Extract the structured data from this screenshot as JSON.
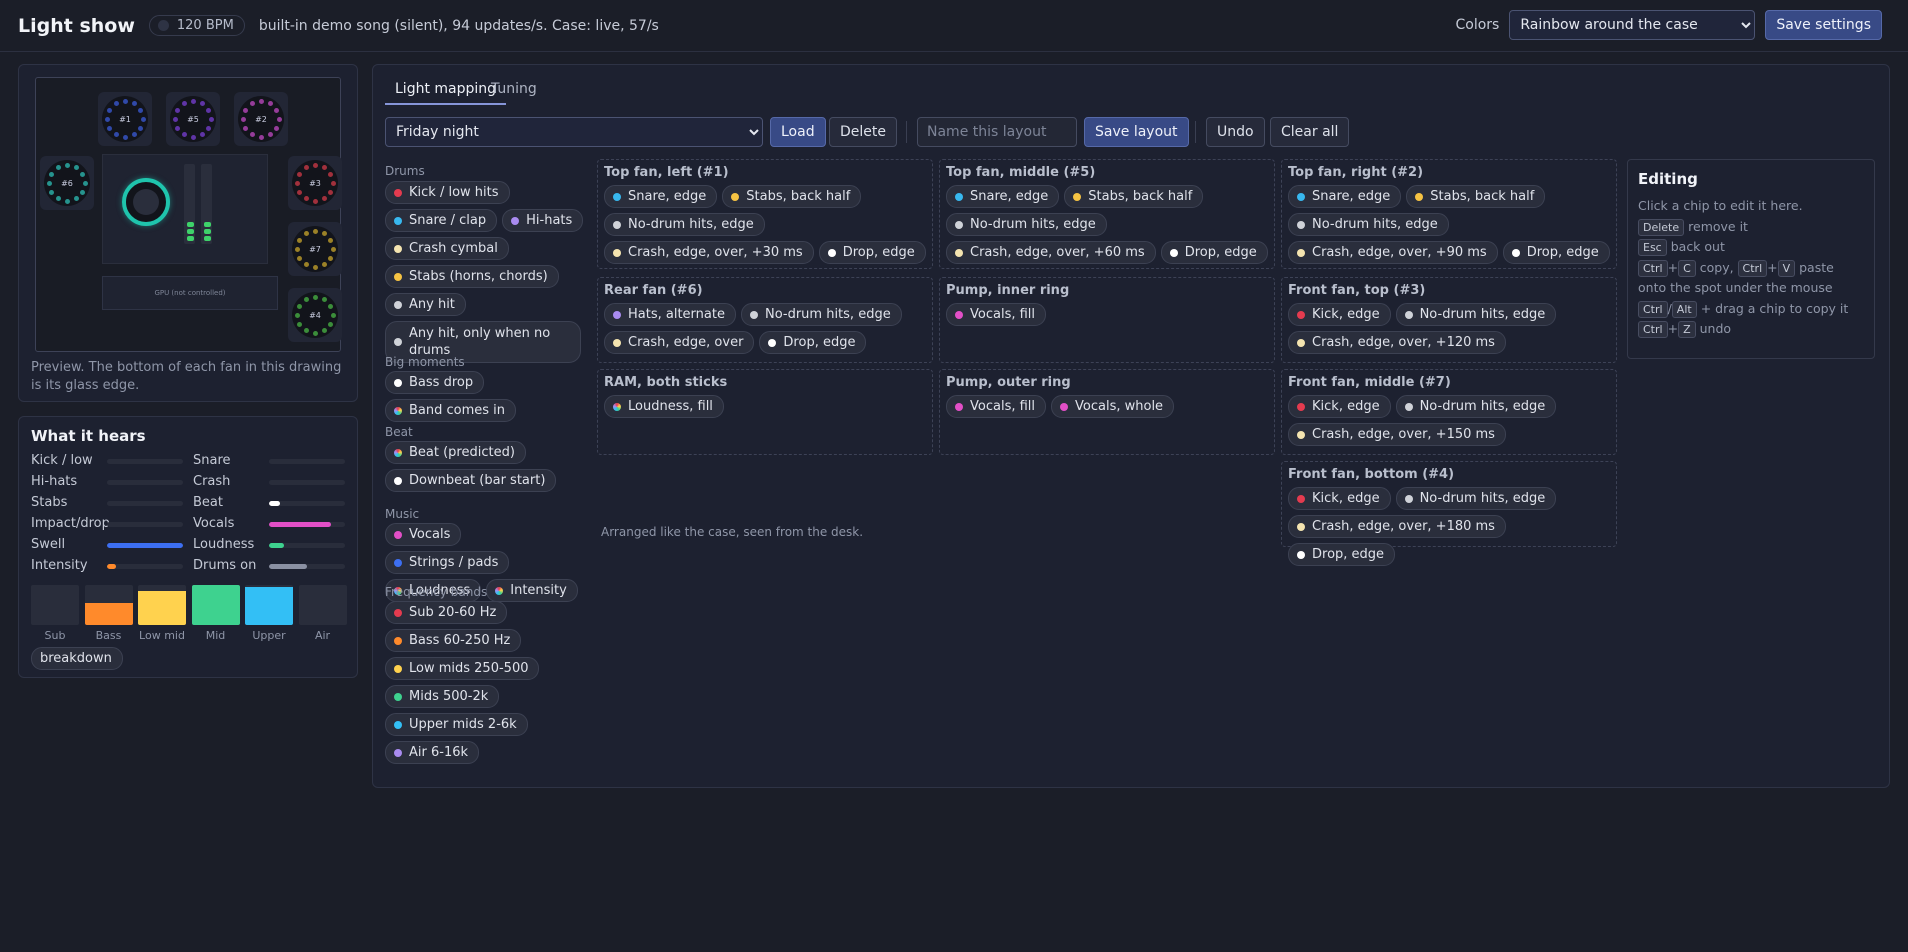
{
  "header": {
    "title": "Light show",
    "bpm": "120 BPM",
    "status": "built-in demo song (silent), 94 updates/s. Case: live, 57/s",
    "colors_label": "Colors",
    "colors_value": "Rainbow around the case",
    "save_settings": "Save settings"
  },
  "preview": {
    "gpu_label": "GPU (not controlled)",
    "caption": "Preview. The bottom of each fan in this drawing is its glass edge.",
    "fans": [
      {
        "id": "#1",
        "color": "#3b5bd9"
      },
      {
        "id": "#5",
        "color": "#7a3fd6"
      },
      {
        "id": "#2",
        "color": "#c24ac4"
      },
      {
        "id": "#6",
        "color": "#2dbdb5"
      },
      {
        "id": "#3",
        "color": "#d23a48"
      },
      {
        "id": "#7",
        "color": "#caa52c"
      },
      {
        "id": "#4",
        "color": "#4ab646"
      }
    ]
  },
  "hears": {
    "title": "What it hears",
    "meters": [
      {
        "label": "Kick / low",
        "level": 0,
        "color": "#555a6a"
      },
      {
        "label": "Snare",
        "level": 0,
        "color": "#555a6a"
      },
      {
        "label": "Hi-hats",
        "level": 0,
        "color": "#555a6a"
      },
      {
        "label": "Crash",
        "level": 0,
        "color": "#555a6a"
      },
      {
        "label": "Stabs",
        "level": 0,
        "color": "#555a6a"
      },
      {
        "label": "Beat",
        "level": 0.14,
        "color": "#ffffff"
      },
      {
        "label": "Impact/drop",
        "level": 0,
        "color": "#555a6a"
      },
      {
        "label": "Vocals",
        "level": 0.82,
        "color": "#e24fc7"
      },
      {
        "label": "Swell",
        "level": 1.0,
        "color": "#3d6ff2"
      },
      {
        "label": "Loudness",
        "level": 0.2,
        "color": "#3ed28f"
      },
      {
        "label": "Intensity",
        "level": 0.12,
        "color": "#ff8a2b"
      },
      {
        "label": "Drums on",
        "level": 0.5,
        "color": "#8a90a2"
      }
    ],
    "bands": [
      {
        "label": "Sub",
        "level": 0,
        "color": "#2a2e3c"
      },
      {
        "label": "Bass",
        "level": 0.55,
        "color": "#ff8a2b"
      },
      {
        "label": "Low mid",
        "level": 0.85,
        "color": "#ffd24e"
      },
      {
        "label": "Mid",
        "level": 1.0,
        "color": "#3ed28f"
      },
      {
        "label": "Upper",
        "level": 0.95,
        "color": "#33bff5"
      },
      {
        "label": "Air",
        "level": 0,
        "color": "#2a2e3c"
      }
    ],
    "breakdown": "breakdown"
  },
  "tabs": [
    {
      "label": "Light mapping",
      "active": true
    },
    {
      "label": "Tuning",
      "active": false
    }
  ],
  "toolbar": {
    "layout_value": "Friday night",
    "load": "Load",
    "delete": "Delete",
    "name_placeholder": "Name this layout",
    "save_layout": "Save layout",
    "undo": "Undo",
    "clear_all": "Clear all"
  },
  "palette": [
    {
      "title": "Drums",
      "chips": [
        {
          "label": "Kick / low hits",
          "color": "#e43b4f"
        },
        {
          "label": "Snare / clap",
          "color": "#38b8ef"
        },
        {
          "label": "Hi-hats",
          "color": "#a98bf0"
        },
        {
          "label": "Crash cymbal",
          "color": "#f4e4b0"
        },
        {
          "label": "Stabs (horns, chords)",
          "color": "#f6c343"
        },
        {
          "label": "Any hit",
          "color": "#cfd2d8"
        },
        {
          "label": "Any hit, only when no drums",
          "color": "#cfd2d8"
        }
      ]
    },
    {
      "title": "Big moments",
      "chips": [
        {
          "label": "Bass drop",
          "color": "#ffffff"
        },
        {
          "label": "Band comes in",
          "color": "multi"
        }
      ]
    },
    {
      "title": "Beat",
      "chips": [
        {
          "label": "Beat (predicted)",
          "color": "multi"
        },
        {
          "label": "Downbeat (bar start)",
          "color": "#ffffff"
        }
      ]
    },
    {
      "title": "Music",
      "chips": [
        {
          "label": "Vocals",
          "color": "#e24fc7"
        },
        {
          "label": "Strings / pads",
          "color": "#3d6ff2"
        },
        {
          "label": "Loudness",
          "color": "multi"
        },
        {
          "label": "Intensity",
          "color": "multi"
        }
      ]
    },
    {
      "title": "Frequency bands",
      "chips": [
        {
          "label": "Sub 20-60 Hz",
          "color": "#e43b4f"
        },
        {
          "label": "Bass 60-250 Hz",
          "color": "#ff8a2b"
        },
        {
          "label": "Low mids 250-500",
          "color": "#ffd24e"
        },
        {
          "label": "Mids 500-2k",
          "color": "#3ed28f"
        },
        {
          "label": "Upper mids 2-6k",
          "color": "#33bff5"
        },
        {
          "label": "Air 6-16k",
          "color": "#a98bf0"
        }
      ]
    }
  ],
  "slots": [
    {
      "title": "Top fan, left (#1)",
      "chips": [
        {
          "label": "Snare, edge",
          "color": "#38b8ef"
        },
        {
          "label": "Stabs, back half",
          "color": "#f6c343"
        },
        {
          "label": "No-drum hits, edge",
          "color": "#cfd2d8"
        },
        {
          "label": "Crash, edge, over, +30 ms",
          "color": "#f4e4b0"
        },
        {
          "label": "Drop, edge",
          "color": "#ffffff"
        }
      ]
    },
    {
      "title": "Top fan, middle (#5)",
      "chips": [
        {
          "label": "Snare, edge",
          "color": "#38b8ef"
        },
        {
          "label": "Stabs, back half",
          "color": "#f6c343"
        },
        {
          "label": "No-drum hits, edge",
          "color": "#cfd2d8"
        },
        {
          "label": "Crash, edge, over, +60 ms",
          "color": "#f4e4b0"
        },
        {
          "label": "Drop, edge",
          "color": "#ffffff"
        }
      ]
    },
    {
      "title": "Top fan, right (#2)",
      "chips": [
        {
          "label": "Snare, edge",
          "color": "#38b8ef"
        },
        {
          "label": "Stabs, back half",
          "color": "#f6c343"
        },
        {
          "label": "No-drum hits, edge",
          "color": "#cfd2d8"
        },
        {
          "label": "Crash, edge, over, +90 ms",
          "color": "#f4e4b0"
        },
        {
          "label": "Drop, edge",
          "color": "#ffffff"
        }
      ]
    },
    {
      "title": "Rear fan (#6)",
      "chips": [
        {
          "label": "Hats, alternate",
          "color": "#a98bf0"
        },
        {
          "label": "No-drum hits, edge",
          "color": "#cfd2d8"
        },
        {
          "label": "Crash, edge, over",
          "color": "#f4e4b0"
        },
        {
          "label": "Drop, edge",
          "color": "#ffffff"
        }
      ]
    },
    {
      "title": "Pump, inner ring",
      "chips": [
        {
          "label": "Vocals, fill",
          "color": "#e24fc7"
        }
      ]
    },
    {
      "title": "Front fan, top (#3)",
      "chips": [
        {
          "label": "Kick, edge",
          "color": "#e43b4f"
        },
        {
          "label": "No-drum hits, edge",
          "color": "#cfd2d8"
        },
        {
          "label": "Crash, edge, over, +120 ms",
          "color": "#f4e4b0"
        }
      ]
    },
    {
      "title": "RAM, both sticks",
      "chips": [
        {
          "label": "Loudness, fill",
          "color": "multi"
        }
      ]
    },
    {
      "title": "Pump, outer ring",
      "chips": [
        {
          "label": "Vocals, fill",
          "color": "#e24fc7"
        },
        {
          "label": "Vocals, whole",
          "color": "#e24fc7"
        }
      ]
    },
    {
      "title": "Front fan, middle (#7)",
      "chips": [
        {
          "label": "Kick, edge",
          "color": "#e43b4f"
        },
        {
          "label": "No-drum hits, edge",
          "color": "#cfd2d8"
        },
        {
          "label": "Crash, edge, over, +150 ms",
          "color": "#f4e4b0"
        }
      ]
    },
    {
      "title": "Front fan, bottom (#4)",
      "chips": [
        {
          "label": "Kick, edge",
          "color": "#e43b4f"
        },
        {
          "label": "No-drum hits, edge",
          "color": "#cfd2d8"
        },
        {
          "label": "Crash, edge, over, +180 ms",
          "color": "#f4e4b0"
        },
        {
          "label": "Drop, edge",
          "color": "#ffffff"
        }
      ]
    }
  ],
  "arranged_note": "Arranged like the case, seen from the desk.",
  "editing": {
    "title": "Editing",
    "intro": "Click a chip to edit it here.",
    "k_delete": "Delete",
    "t_delete": "remove it",
    "k_esc": "Esc",
    "t_esc": "back out",
    "k_ctrl": "Ctrl",
    "k_c": "C",
    "t_copy": "copy,",
    "k_v": "V",
    "t_paste": "paste",
    "t_paste2": "onto the spot under the mouse",
    "k_alt": "Alt",
    "t_drag": "+ drag a chip to copy it",
    "k_z": "Z",
    "t_undo": "undo",
    "plus": "+",
    "slash": "/"
  }
}
